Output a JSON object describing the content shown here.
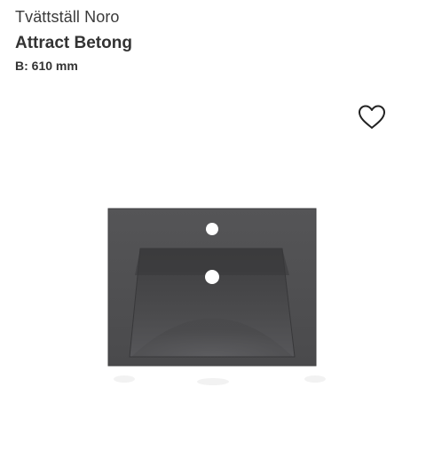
{
  "product": {
    "category": "Tvättställ Noro",
    "name": "Attract Betong",
    "dimension": "B: 610 mm"
  },
  "icons": {
    "favorite": "heart-outline-icon"
  },
  "colors": {
    "text": "#333333",
    "basin_concrete": "#4a4a4c",
    "background": "#ffffff"
  }
}
